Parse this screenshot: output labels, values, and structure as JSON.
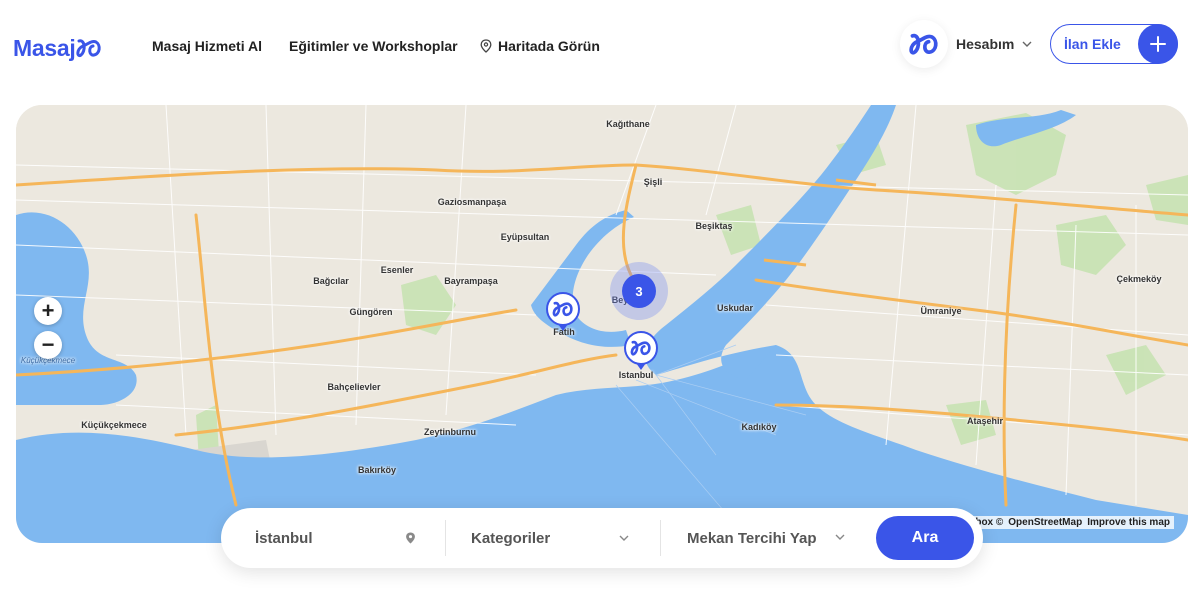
{
  "header": {
    "logo_text": "Masaj",
    "nav": {
      "massage_service": "Masaj Hizmeti Al",
      "trainings": "Eğitimler ve Workshoplar",
      "map_view": "Haritada Görün"
    },
    "account_label": "Hesabım",
    "add_listing_label": "İlan Ekle"
  },
  "map": {
    "places": {
      "kagithane": "Kağıthane",
      "sisli": "Şişli",
      "gaziosmanpasa": "Gaziosmanpaşa",
      "eyupsultan": "Eyüpsultan",
      "besiktas": "Beşiktaş",
      "bagcilar": "Bağcılar",
      "esenler": "Esenler",
      "bayrampasa": "Bayrampaşa",
      "gungoren": "Güngören",
      "fatih": "Fatih",
      "beyoglu": "Bey",
      "uskudar": "Uskudar",
      "umraniye": "Ümraniye",
      "cekmekoy": "Çekmeköy",
      "istanbul": "Istanbul",
      "bahcelievler": "Bahçelievler",
      "kucukcekmece": "Küçükçekmece",
      "kucukcekmece_lake": "Küçükçekmece",
      "zeytinburnu": "Zeytinburnu",
      "bakirkoy": "Bakırköy",
      "kadikoy": "Kadıköy",
      "atasehir": "Ataşehir"
    },
    "cluster_count": "3",
    "markers": [
      "Fatih",
      "Istanbul"
    ],
    "zoom_in": "+",
    "zoom_out": "−",
    "attribution": {
      "mapbox": "box ©",
      "osm": "OpenStreetMap",
      "improve": "Improve this map"
    }
  },
  "search": {
    "location_value": "İstanbul",
    "category_placeholder": "Kategoriler",
    "venue_placeholder": "Mekan Tercihi Yap",
    "submit_label": "Ara"
  },
  "colors": {
    "brand": "#3a55e8",
    "water": "#7fb8f0",
    "land": "#ece8df",
    "park": "#c9e3b4",
    "highway": "#f5b65a"
  }
}
